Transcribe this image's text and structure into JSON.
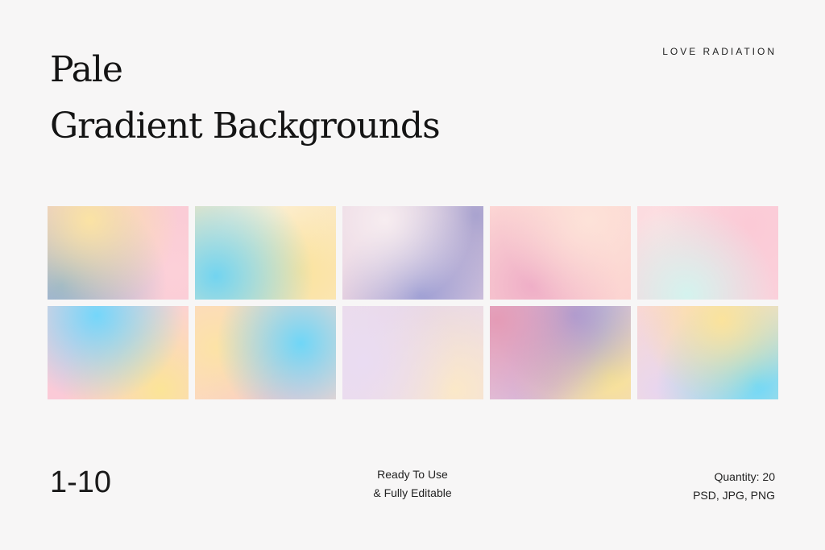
{
  "header": {
    "title_line1": "Pale",
    "title_line2": "Gradient Backgrounds",
    "brand": "LOVE RADIATION"
  },
  "tiles": [
    {
      "base": "#f9c9d4",
      "blobs": [
        [
          "#fbe3a4",
          "30% 15%"
        ],
        [
          "#8fb2cc",
          "10% 85%"
        ],
        [
          "#fcd0d8",
          "90% 70%"
        ]
      ]
    },
    {
      "base": "#fbe7c2",
      "blobs": [
        [
          "#72d4f0",
          "15% 75%"
        ],
        [
          "#fbe39e",
          "75% 70%"
        ],
        [
          "#fcf2e0",
          "55% 10%"
        ]
      ]
    },
    {
      "base": "#e9d3e1",
      "blobs": [
        [
          "#f7edf0",
          "30% 15%"
        ],
        [
          "#9c9dd3",
          "55% 95%"
        ],
        [
          "#a9a3cf",
          "95% 10%"
        ]
      ]
    },
    {
      "base": "#fcd6d4",
      "blobs": [
        [
          "#fde2d8",
          "70% 15%"
        ],
        [
          "#efaec7",
          "30% 85%"
        ],
        [
          "#fcd3d0",
          "90% 70%"
        ]
      ]
    },
    {
      "base": "#fbd2dc",
      "blobs": [
        [
          "#d4f3ee",
          "35% 95%"
        ],
        [
          "#fbcad6",
          "80% 20%"
        ],
        [
          "#fde0e2",
          "20% 20%"
        ]
      ]
    },
    {
      "base": "#fcd0d8",
      "blobs": [
        [
          "#74d6fa",
          "35% 10%"
        ],
        [
          "#fbe497",
          "80% 90%"
        ],
        [
          "#fbc9d7",
          "15% 90%"
        ]
      ]
    },
    {
      "base": "#fbd5cc",
      "blobs": [
        [
          "#6fd6f7",
          "75% 40%"
        ],
        [
          "#fce3a6",
          "15% 45%"
        ],
        [
          "#f9c2d2",
          "50% 95%"
        ]
      ]
    },
    {
      "base": "#ecdcea",
      "blobs": [
        [
          "#eadcf2",
          "15% 60%"
        ],
        [
          "#fbe8c8",
          "80% 90%"
        ],
        [
          "#e7d6e6",
          "60% 15%"
        ]
      ]
    },
    {
      "base": "#e6cbe0",
      "blobs": [
        [
          "#e49bb6",
          "5% 15%"
        ],
        [
          "#9d9bd6",
          "60% 10%"
        ],
        [
          "#fbe592",
          "85% 75%"
        ],
        [
          "#c8b3e2",
          "45% 85%"
        ]
      ]
    },
    {
      "base": "#fde0c8",
      "blobs": [
        [
          "#fbe39c",
          "60% 15%"
        ],
        [
          "#6fd8f8",
          "85% 85%"
        ],
        [
          "#e8d6ef",
          "15% 90%"
        ],
        [
          "#fbd5cf",
          "15% 20%"
        ]
      ]
    }
  ],
  "footer": {
    "range": "1-10",
    "line1": "Ready To Use",
    "line2": "& Fully Editable",
    "quantity": "Quantity: 20",
    "formats": "PSD, JPG, PNG"
  }
}
